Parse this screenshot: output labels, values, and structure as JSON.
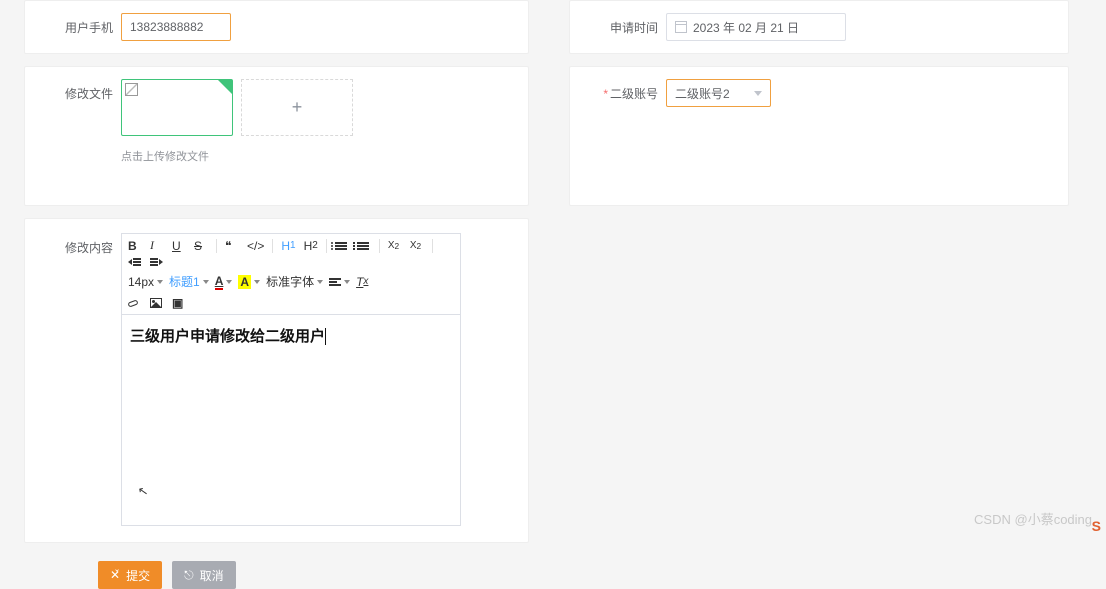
{
  "left": {
    "phone_label": "用户手机",
    "phone_value": "13823888882",
    "file_label": "修改文件",
    "upload_add": "+",
    "upload_tip": "点击上传修改文件",
    "content_label": "修改内容",
    "editor_text": "三级用户申请修改给二级用户"
  },
  "right": {
    "apply_time_label": "申请时间",
    "apply_time_value": "2023 年 02 月 21 日",
    "account_label": "二级账号",
    "account_value": "二级账号2"
  },
  "toolbar": {
    "bold": "B",
    "italic": "I",
    "underline": "U",
    "strike": "S",
    "quote1": "“",
    "quote2": "”",
    "h1": "H₁",
    "h2": "H₂",
    "sub": "X₂",
    "sup": "X²",
    "font_size": "14px",
    "heading": "标题1",
    "font_color": "A",
    "bg_color": "A",
    "font_family": "标准字体",
    "code": "</>"
  },
  "actions": {
    "submit": "提交",
    "cancel": "取消"
  },
  "watermark": "CSDN @小蔡coding",
  "fragment": "S"
}
